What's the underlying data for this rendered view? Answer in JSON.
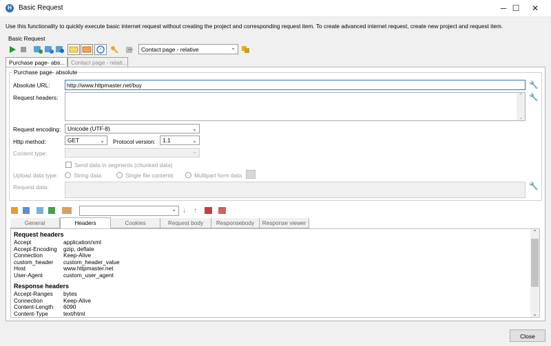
{
  "window": {
    "title": "Basic Request",
    "minimize": "─",
    "maximize": "☐",
    "close": "✕"
  },
  "description": "Use this functionality to quickly execute basic internet request without creating the project and corresponding request item. To create advanced internet request, create new project and request item.",
  "group_label": "Basic Request",
  "toolbar": {
    "items_combo": "Contact page - relative",
    "icons": [
      "play-icon",
      "stop-icon",
      "add-request-icon",
      "add-copy-icon",
      "settings-icon",
      "note-icon",
      "frame-icon",
      "timer-icon",
      "key-icon",
      "export-icon",
      "manage-icon"
    ]
  },
  "tabs": [
    {
      "label": "Purchase page- abs..."
    },
    {
      "label": "Contact page - relati..."
    }
  ],
  "form": {
    "section_title": "Purchase page- absolute",
    "absolute_url_label": "Absolute URL:",
    "absolute_url_value": "http://www.httpmaster.net/buy",
    "request_headers_label": "Request headers:",
    "request_encoding_label": "Request encoding:",
    "request_encoding_value": "Unicode (UTF-8)",
    "http_method_label": "Http method:",
    "http_method_value": "GET",
    "protocol_version_label": "Protocol version:",
    "protocol_version_value": "1.1",
    "content_type_label": "Content type:",
    "send_segments_label": "Send data in segments (chunked data)",
    "upload_data_type_label": "Upload data type:",
    "upload_options": [
      "String data",
      "Single file contents",
      "Multipart form data"
    ],
    "request_data_label": "Request data:"
  },
  "bottom_tabs": [
    "General",
    "Headers",
    "Cookies",
    "Request body",
    "Responsebody",
    "Response viewer"
  ],
  "active_bottom_tab": "Headers",
  "headers_view": {
    "request_title": "Request headers",
    "request": [
      [
        "Accept",
        "application/xml"
      ],
      [
        "Accept-Encoding",
        "gzip, deflate"
      ],
      [
        "Connection",
        "Keep-Alive"
      ],
      [
        "custom_header",
        "custom_header_value"
      ],
      [
        "Host",
        "www.httpmaster.net"
      ],
      [
        "User-Agent",
        "custom_user_agent"
      ]
    ],
    "response_title": "Response headers",
    "response": [
      [
        "Accept-Ranges",
        "bytes"
      ],
      [
        "Connection",
        "Keep-Alive"
      ],
      [
        "Content-Length",
        "6090"
      ],
      [
        "Content-Type",
        "text/html"
      ]
    ]
  },
  "close_button": "Close",
  "colors": {
    "accent": "#2f6db5",
    "wrench": "#e07a10",
    "play": "#1a9a2a"
  }
}
